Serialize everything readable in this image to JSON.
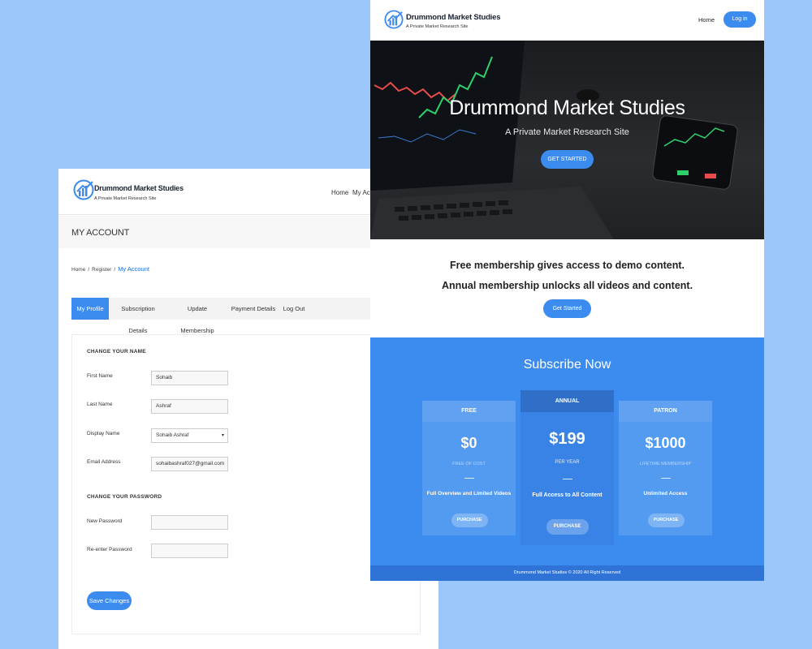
{
  "account": {
    "brand": "Drummond Market Studies",
    "tagline": "A Private Market Research Site",
    "nav": [
      "Home",
      "My Acc"
    ],
    "page_title": "MY ACCOUNT",
    "breadcrumb": [
      "Home",
      "Register",
      "My Account"
    ],
    "tabs": [
      "My Profile",
      "Subscription Details",
      "Update Membership",
      "Payment Details",
      "Log Out"
    ],
    "active_tab": "My Profile",
    "change_name_heading": "CHANGE YOUR NAME",
    "fields": {
      "first_name": {
        "label": "First Name",
        "value": "Sohaib"
      },
      "last_name": {
        "label": "Last Name",
        "value": "Ashraf"
      },
      "display_name": {
        "label": "Display Name",
        "value": "Sohaib Ashraf"
      },
      "email": {
        "label": "Email Address",
        "value": "sohaibashraf027@gmail.com"
      }
    },
    "change_password_heading": "CHANGE YOUR PASSWORD",
    "password_fields": {
      "new": {
        "label": "New Password",
        "value": ""
      },
      "reenter": {
        "label": "Re-enter Password",
        "value": ""
      }
    },
    "save_label": "Save Changes"
  },
  "landing": {
    "brand": "Drummond Market Studies",
    "tagline": "A Private Market Research Site",
    "nav_home": "Home",
    "login_label": "Log in",
    "hero_title": "Drummond Market Studies",
    "hero_subtitle": "A Private Market Research Site",
    "hero_button": "GET STARTED",
    "pitch_line1": "Free membership gives access to demo content.",
    "pitch_line2": "Annual membership unlocks all videos and content.",
    "pitch_button": "Get Started",
    "subscribe_title": "Subscribe Now",
    "plans": [
      {
        "name": "FREE",
        "price": "$0",
        "period": "FREE OF COST",
        "feature": "Full Overview and Limited Videos",
        "button": "PURCHASE"
      },
      {
        "name": "ANNUAL",
        "price": "$199",
        "period": "PER YEAR",
        "feature": "Full Access to All Content",
        "button": "PURCHASE"
      },
      {
        "name": "PATRON",
        "price": "$1000",
        "period": "LIFETIME MEMBERSHIP",
        "feature": "Unlimited Access",
        "button": "PURCHASE"
      }
    ],
    "footer": "Drummond Market Studies © 2020 All Right Reserved"
  },
  "colors": {
    "accent": "#3c8cf0",
    "page_bg": "#9cc7fb",
    "hero_bg": "#1b1c1f"
  },
  "icons": [
    "logo-chart-icon",
    "select-caret-icon"
  ]
}
